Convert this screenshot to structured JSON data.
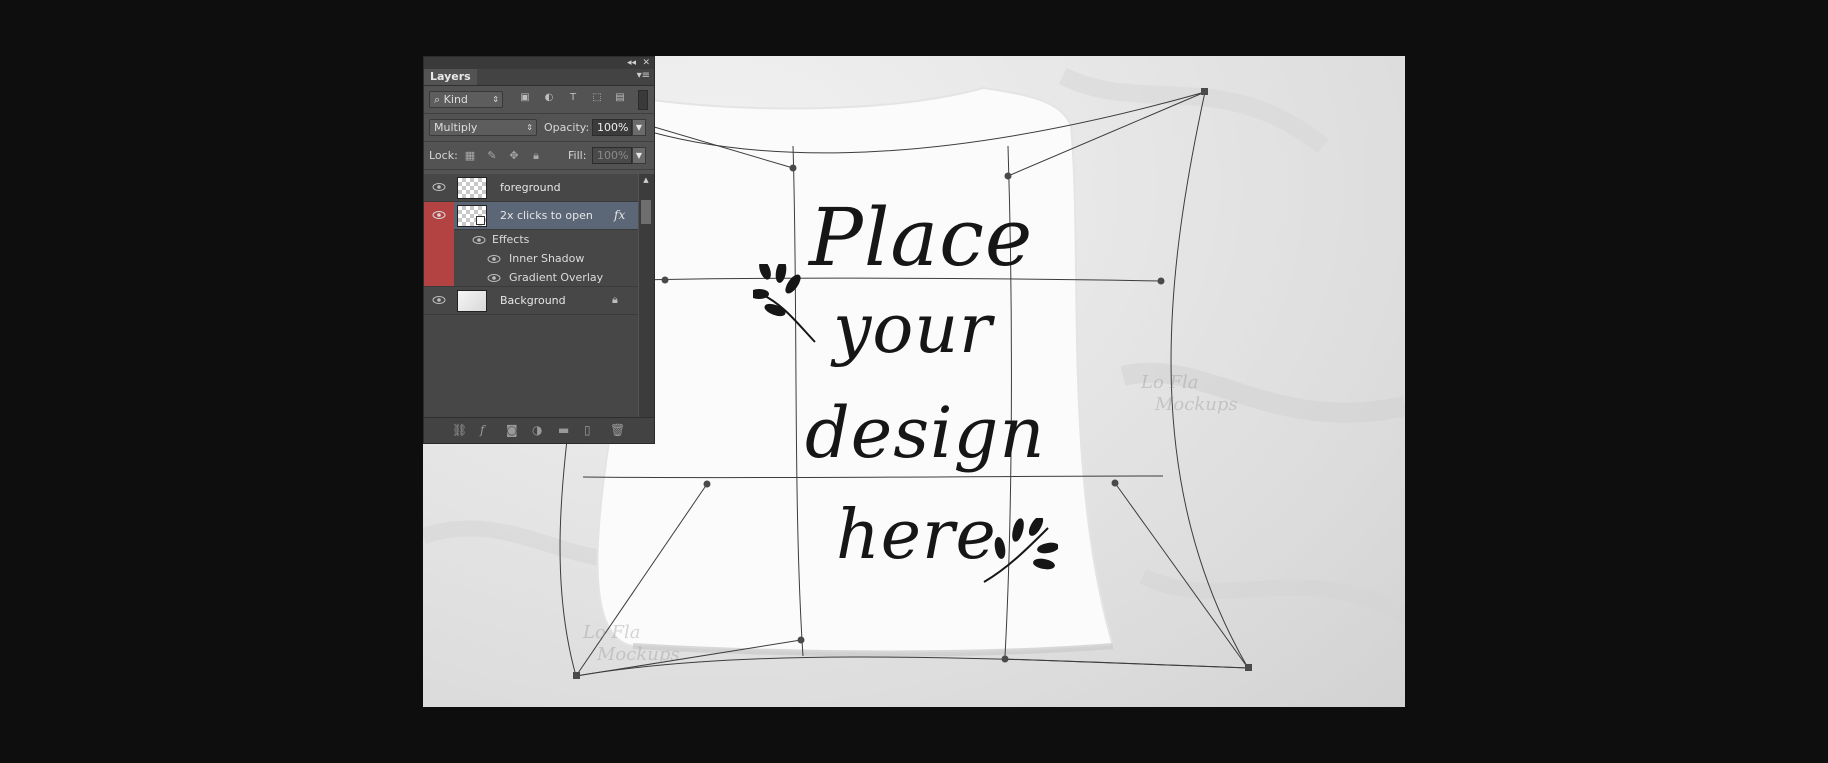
{
  "panel": {
    "collapse_icon": "◂◂",
    "close_icon": "✕",
    "tab_label": "Layers",
    "menu_icon": "▾≡",
    "filter": {
      "kind_label": "Kind"
    },
    "blend_mode": "Multiply",
    "opacity_label": "Opacity:",
    "opacity_value": "100%",
    "lock_label": "Lock:",
    "fill_label": "Fill:",
    "fill_value": "100%",
    "fx_label": "fx",
    "layers": [
      {
        "name": "foreground"
      },
      {
        "name": "2x clicks to open"
      },
      {
        "name": "Background"
      }
    ],
    "effects": {
      "label": "Effects",
      "items": [
        "Inner Shadow",
        "Gradient Overlay"
      ]
    }
  },
  "design_text": [
    "Place",
    "your",
    "design",
    "here"
  ],
  "watermark": [
    "Lo Fla",
    "Mockups"
  ],
  "colors": {
    "panel_bg": "#535353",
    "selected_row": "#5b6677",
    "effects_marker": "#b34242",
    "app_bg": "#0e0e0e"
  }
}
